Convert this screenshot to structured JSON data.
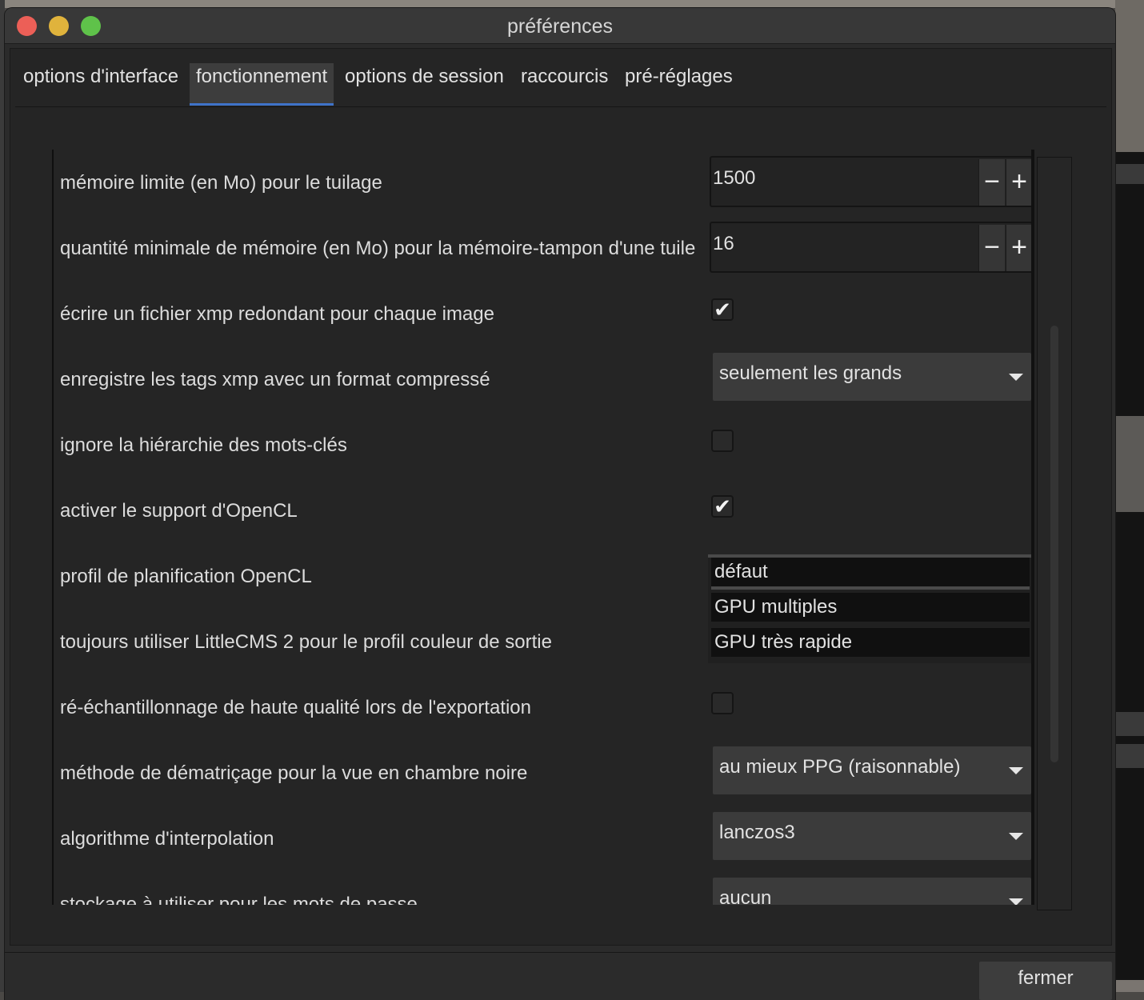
{
  "window": {
    "title": "préférences"
  },
  "tabs": [
    {
      "label": "options d'interface",
      "active": false
    },
    {
      "label": "fonctionnement",
      "active": true
    },
    {
      "label": "options de session",
      "active": false
    },
    {
      "label": "raccourcis",
      "active": false
    },
    {
      "label": "pré-réglages",
      "active": false
    }
  ],
  "settings": {
    "tiling_memory": {
      "label": "mémoire limite (en Mo) pour le tuilage",
      "value": "1500"
    },
    "tile_buffer": {
      "label": "quantité minimale de mémoire (en Mo) pour la mémoire-tampon d'une tuile",
      "value": "16"
    },
    "redundant_xmp": {
      "label": "écrire un fichier xmp redondant pour chaque image",
      "checked": true
    },
    "compress_xmp": {
      "label": "enregistre les tags xmp avec un format compressé",
      "value": "seulement les grands"
    },
    "ignore_hierarchy": {
      "label": "ignore la hiérarchie des mots-clés",
      "checked": false
    },
    "opencl": {
      "label": "activer le support d'OpenCL",
      "checked": true
    },
    "opencl_profile": {
      "label": "profil de planification OpenCL",
      "options": [
        "défaut",
        "GPU multiples",
        "GPU très rapide"
      ],
      "selected": "défaut"
    },
    "littlecms": {
      "label": "toujours utiliser LittleCMS 2 pour le profil couleur de sortie"
    },
    "hq_resample": {
      "label": "ré-échantillonnage de haute qualité lors de l'exportation",
      "checked": false
    },
    "demosaic": {
      "label": "méthode de dématriçage pour la vue en chambre noire",
      "value": "au mieux PPG (raisonnable)"
    },
    "interpolation": {
      "label": "algorithme d'interpolation",
      "value": "lanczos3"
    },
    "password_storage": {
      "label": "stockage à utiliser pour les mots de passe",
      "value": "aucun"
    }
  },
  "icons": {
    "check": "✔",
    "minus": "−",
    "plus": "+"
  },
  "footer": {
    "close_label": "fermer"
  },
  "colors": {
    "accent": "#3f73c8",
    "close": "#ec5f57",
    "minimize": "#e0b33c",
    "maximize": "#5fc24a"
  }
}
